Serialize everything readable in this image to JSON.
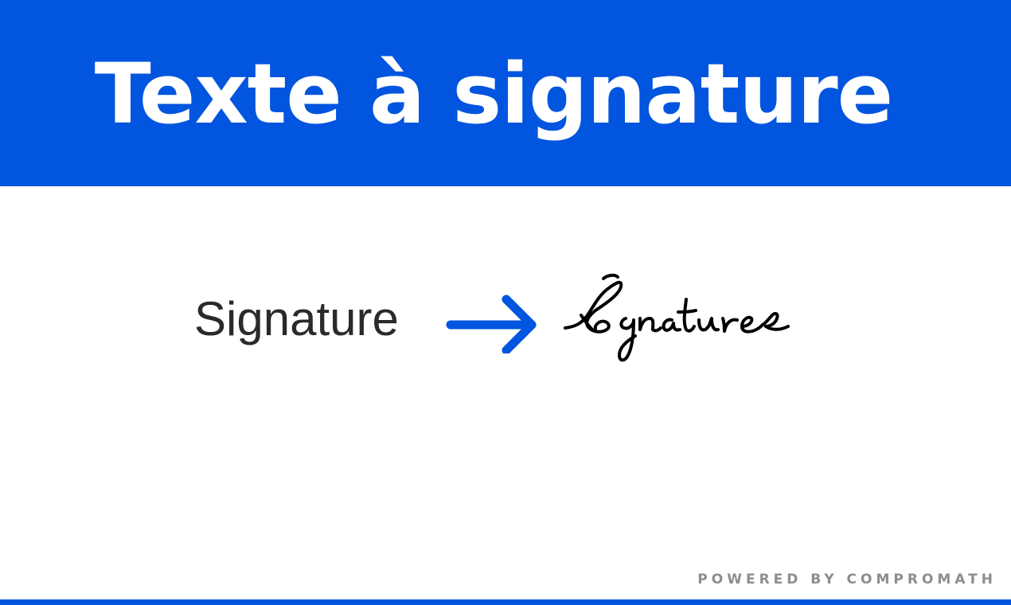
{
  "header": {
    "title": "Texte à signature"
  },
  "demo": {
    "input_text": "Signature",
    "arrow_icon": "arrow-right-icon",
    "output_signature": "Signature"
  },
  "footer": {
    "powered_by": "POWERED BY COMPROMATH"
  },
  "colors": {
    "brand_blue": "#0255de",
    "text_dark": "#2a2a2a",
    "footer_gray": "#8d8d8d",
    "signature_ink": "#000000"
  }
}
